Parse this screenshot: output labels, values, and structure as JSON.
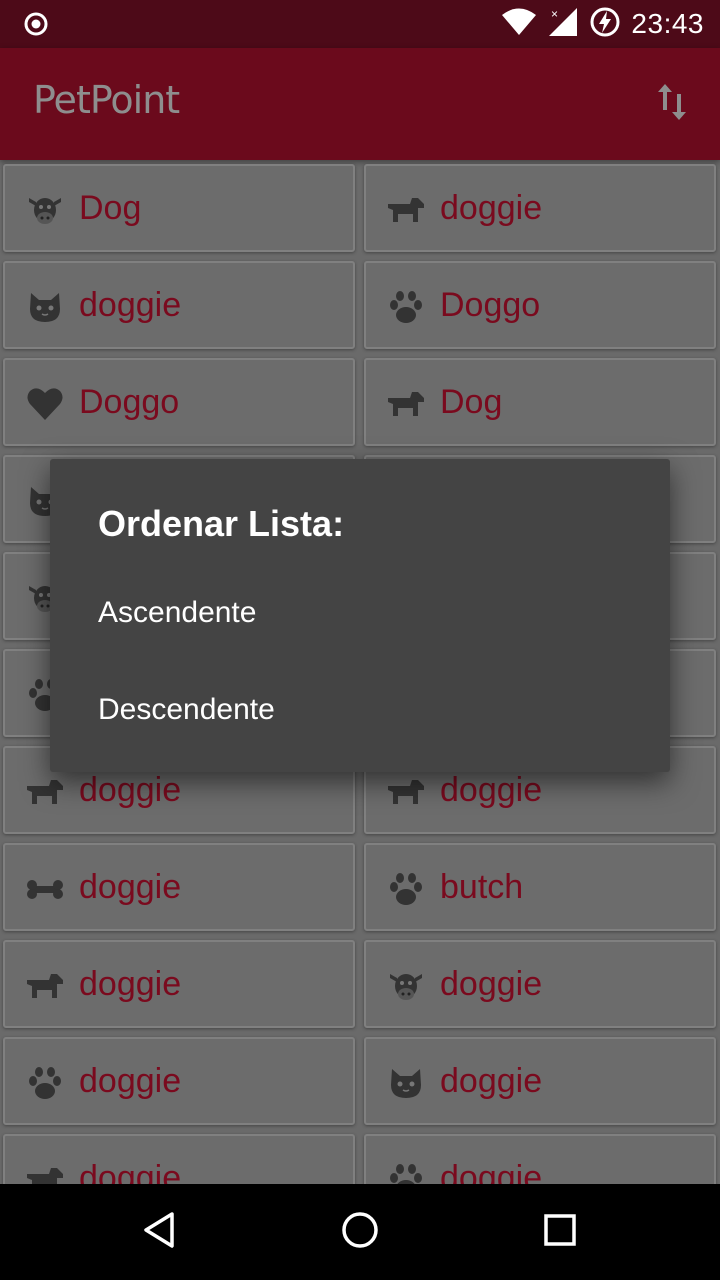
{
  "status_bar": {
    "time": "23:43",
    "icons": [
      "radio-indicator-icon",
      "wifi-icon",
      "signal-icon",
      "battery-charging-icon"
    ]
  },
  "app_bar": {
    "title": "PetPoint",
    "sort_icon": "sort-icon"
  },
  "pets": [
    {
      "name": "Dog",
      "icon": "cow-icon"
    },
    {
      "name": "doggie",
      "icon": "dog-icon"
    },
    {
      "name": "doggie",
      "icon": "cat-icon"
    },
    {
      "name": "Doggo",
      "icon": "paw-icon"
    },
    {
      "name": "Doggo",
      "icon": "heart-icon"
    },
    {
      "name": "Dog",
      "icon": "dog-icon"
    },
    {
      "name": "",
      "icon": "cat-icon"
    },
    {
      "name": "",
      "icon": ""
    },
    {
      "name": "",
      "icon": "cow-icon"
    },
    {
      "name": "",
      "icon": ""
    },
    {
      "name": "",
      "icon": "paw-icon"
    },
    {
      "name": "",
      "icon": ""
    },
    {
      "name": "doggie",
      "icon": "dog-icon"
    },
    {
      "name": "doggie",
      "icon": "dog-icon"
    },
    {
      "name": "doggie",
      "icon": "bone-icon"
    },
    {
      "name": "butch",
      "icon": "paw-icon"
    },
    {
      "name": "doggie",
      "icon": "dog-icon"
    },
    {
      "name": "doggie",
      "icon": "cow-icon"
    },
    {
      "name": "doggie",
      "icon": "paw-icon"
    },
    {
      "name": "doggie",
      "icon": "cat-icon"
    },
    {
      "name": "doggie",
      "icon": "dog-icon"
    },
    {
      "name": "doggie",
      "icon": "paw-icon"
    }
  ],
  "dialog": {
    "title": "Ordenar Lista:",
    "options": [
      "Ascendente",
      "Descendente"
    ]
  },
  "nav_bar": {
    "icons": [
      "back-icon",
      "home-icon",
      "recents-icon"
    ]
  },
  "colors": {
    "status_bar": "#4d0a18",
    "app_bar": "#6b0a1c",
    "accent_text": "#7a0a1e",
    "dialog_bg": "#444444"
  }
}
